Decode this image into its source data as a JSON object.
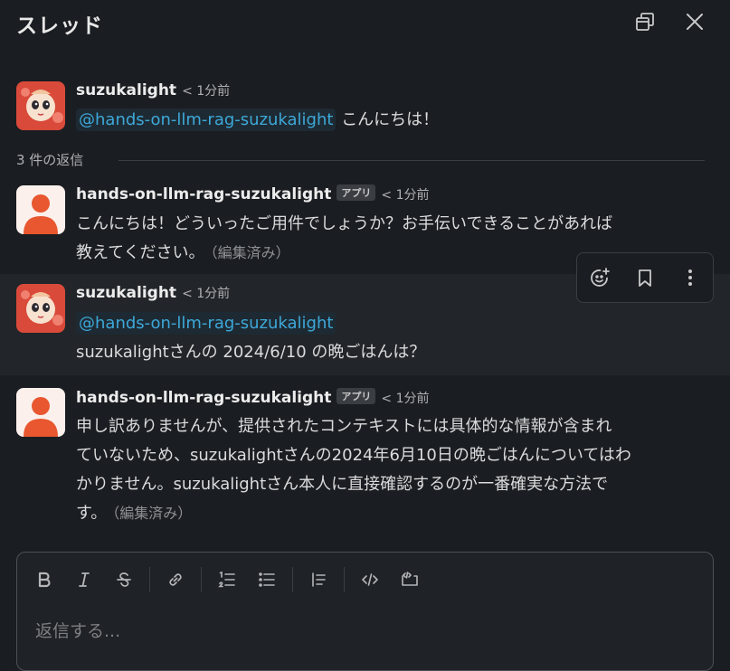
{
  "header": {
    "title": "スレッド"
  },
  "messages": [
    {
      "author": "suzukalight",
      "time": "< 1分前",
      "mention": "@hands-on-llm-rag-suzukalight",
      "text": "こんにちは！"
    },
    {
      "author": "hands-on-llm-rag-suzukalight",
      "badge": "アプリ",
      "time": "< 1分前",
      "line1": "こんにちは！どういったご用件でしょうか？お手伝いできることがあれば",
      "line2": "教えてください。",
      "edited": "（編集済み）"
    },
    {
      "author": "suzukalight",
      "time": "< 1分前",
      "mention": "@hands-on-llm-rag-suzukalight",
      "text": "suzukalightさんの 2024/6/10 の晩ごはんは？"
    },
    {
      "author": "hands-on-llm-rag-suzukalight",
      "badge": "アプリ",
      "time": "< 1分前",
      "line1": "申し訳ありませんが、提供されたコンテキストには具体的な情報が含まれ",
      "line2": "ていないため、suzukalightさんの2024年6月10日の晩ごはんについてはわ",
      "line3": "かりません。suzukalightさん本人に直接確認するのが一番確実な方法で",
      "line4": "す。",
      "edited": "（編集済み）"
    }
  ],
  "replies_label": "3 件の返信",
  "composer": {
    "placeholder": "返信する..."
  },
  "icons": {
    "header": [
      "popout-icon",
      "close-icon"
    ],
    "actions": [
      "add-reaction-icon",
      "bookmark-icon",
      "more-vertical-icon"
    ],
    "toolbar": [
      "bold-icon",
      "italic-icon",
      "strikethrough-icon",
      "link-icon",
      "ordered-list-icon",
      "bullet-list-icon",
      "blockquote-icon",
      "code-icon",
      "code-block-icon"
    ]
  },
  "colors": {
    "background": "#1a1d21",
    "hover_row": "#222529",
    "mention": "#3da8d8",
    "bot_avatar": "#e8572f"
  }
}
